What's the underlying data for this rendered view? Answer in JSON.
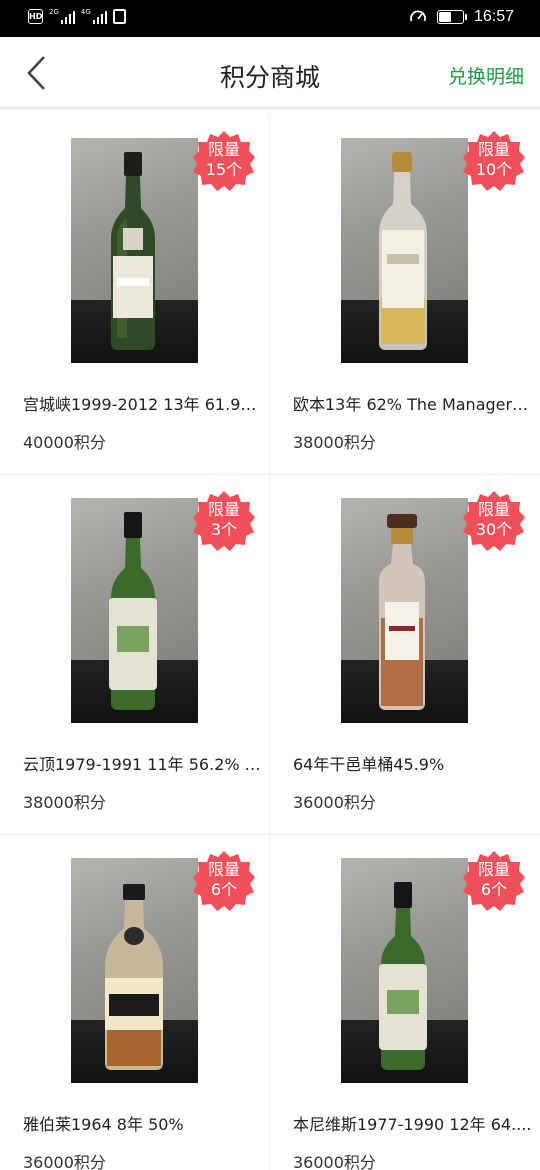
{
  "status_bar": {
    "hd": "HD",
    "signal_1_tag": "2G",
    "signal_2_tag": "4G",
    "time": "16:57",
    "battery_level": 0.55
  },
  "nav": {
    "title": "积分商城",
    "right_link": "兑换明细"
  },
  "colors": {
    "accent_green": "#1c9a43",
    "badge_red": "#f0505a"
  },
  "products": [
    {
      "name": "宫城峡1999-2012 13年 61.9%...",
      "price": "40000积分",
      "limit_1": "限量",
      "limit_2": "15个"
    },
    {
      "name": "欧本13年 62% The Manager&...",
      "price": "38000积分",
      "limit_1": "限量",
      "limit_2": "10个"
    },
    {
      "name": "云顶1979-1991 11年 56.2% S...",
      "price": "38000积分",
      "limit_1": "限量",
      "limit_2": "3个"
    },
    {
      "name": "64年干邑单桶45.9%",
      "price": "36000积分",
      "limit_1": "限量",
      "limit_2": "30个"
    },
    {
      "name": "雅伯莱1964 8年 50%",
      "price": "36000积分",
      "limit_1": "限量",
      "limit_2": "6个"
    },
    {
      "name": "本尼维斯1977-1990 12年 64....",
      "price": "36000积分",
      "limit_1": "限量",
      "limit_2": "6个"
    }
  ]
}
